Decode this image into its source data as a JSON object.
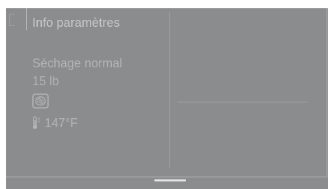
{
  "header": {
    "title": "Info paramètres",
    "back_icon": "back-bracket-icon"
  },
  "settings": {
    "program": "Séchage normal",
    "load": "15 lb",
    "dry_icon": "drying-level-icon",
    "temperature_icon": "thermometer-icon",
    "temperature": "147°F"
  },
  "colors": {
    "screen_bg": "#8b8c8e",
    "text": "#b3b4b6",
    "title_text": "#c9cacc",
    "home_indicator": "#e4e5e7"
  }
}
